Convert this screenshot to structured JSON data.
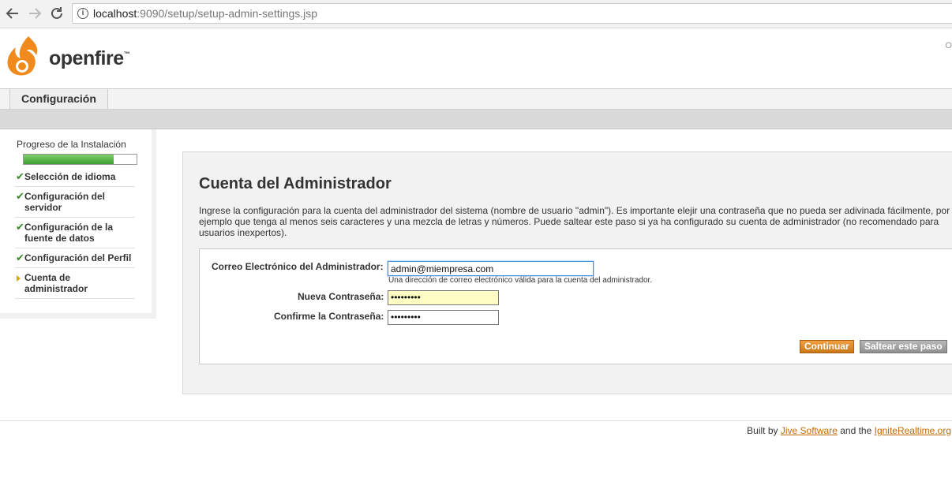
{
  "browser": {
    "url_host": "localhost",
    "url_rest": ":9090/setup/setup-admin-settings.jsp"
  },
  "header": {
    "logo_text": "openfire",
    "logo_tm": "™",
    "right_text": "Op"
  },
  "tabs": [
    {
      "label": "Configuración"
    }
  ],
  "sidebar": {
    "progress_title": "Progreso de la Instalación",
    "progress_fraction": 0.8,
    "steps": [
      {
        "label": "Selección de idioma",
        "status": "done"
      },
      {
        "label": "Configuración del servidor",
        "status": "done"
      },
      {
        "label": "Configuración de la fuente de datos",
        "status": "done"
      },
      {
        "label": "Configuración del Perfil",
        "status": "done"
      },
      {
        "label": "Cuenta de administrador",
        "status": "current"
      }
    ]
  },
  "main": {
    "title": "Cuenta del Administrador",
    "intro": "Ingrese la configuración para la cuenta del administrador del sistema (nombre de usuario \"admin\"). Es importante elejir una contraseña que no pueda ser adivinada fácilmente, por ejemplo que tenga al menos seis caracteres y una mezcla de letras y números. Puede saltear este paso si ya ha configurado su cuenta de administrador (no recomendado para usuarios inexpertos).",
    "form": {
      "email_label": "Correo Electrónico del Administrador:",
      "email_value": "admin@miempresa.com",
      "email_hint": "Una dirección de correo electrónico válida para la cuenta del administrador.",
      "password_label": "Nueva Contraseña:",
      "password_value": "•••••••••",
      "confirm_label": "Confirme la Contraseña:",
      "confirm_value": "•••••••••"
    },
    "buttons": {
      "continue": "Continuar",
      "skip": "Saltear este paso"
    }
  },
  "footer": {
    "prefix": "Built by ",
    "link1": "Jive Software",
    "middle": " and the ",
    "link2": "IgniteRealtime.org"
  },
  "colors": {
    "accent_orange": "#d98a2b",
    "check_green": "#3a8a2a",
    "progress_green": "#4caf3a",
    "link_orange": "#c56a00"
  }
}
